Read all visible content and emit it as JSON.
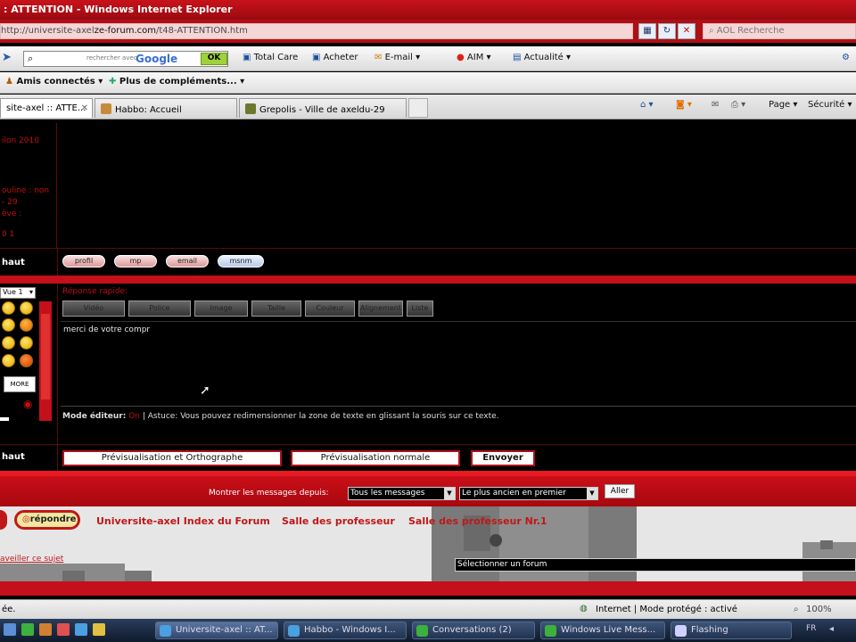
{
  "window": {
    "title": ": ATTENTION - Windows Internet Explorer"
  },
  "address": {
    "url_pre": "http://universite-axel",
    "url_host": "ze-forum.com",
    "url_post": "/t48-ATTENTION.htm",
    "search_placeholder": "AOL Recherche"
  },
  "toolbar": {
    "google_hint": "rechercher avec",
    "google": "Google",
    "ok": "OK",
    "total_care": "Total Care",
    "acheter": "Acheter",
    "email": "E-mail",
    "aim": "AIM",
    "actualite": "Actualité"
  },
  "linkbar": {
    "amis": "Amis connectés",
    "plus": "Plus de compléments..."
  },
  "tabs": [
    {
      "label": "site-axel :: ATTE..."
    },
    {
      "label": "Habbo: Accueil"
    },
    {
      "label": "Grepolis - Ville de axeldu-29"
    }
  ],
  "tabtools": {
    "page": "Page",
    "securite": "Sécurité"
  },
  "post": {
    "side_text": [
      "ilon 2010",
      "",
      "ouline : non",
      "- 29",
      "ève :",
      "",
      "0 1"
    ],
    "haut": "haut",
    "buttons": [
      "profil",
      "mp",
      "email",
      "msnm"
    ]
  },
  "reply": {
    "title": "Réponse rapide:",
    "format_buttons": [
      "Vidéo",
      "Police",
      "Image",
      "Taille",
      "Couleur",
      "Alignement",
      "Liste"
    ],
    "text": "merci de votre compr",
    "mode_label": "Mode éditeur:",
    "mode_value": "On",
    "tip": "| Astuce: Vous pouvez redimensionner la zone de texte en glissant la souris sur ce texte.",
    "smiley_select": "Vue 1",
    "more": "MORE"
  },
  "actions": {
    "haut": "haut",
    "preview_spell": "Prévisualisation et Orthographe",
    "preview": "Prévisualisation normale",
    "send": "Envoyer"
  },
  "filter": {
    "label": "Montrer les messages depuis:",
    "period": "Tous les messages",
    "order": "Le plus ancien en premier",
    "go": "Aller"
  },
  "bottomnav": {
    "reply": "répondre",
    "index": "Universite-axel Index du Forum",
    "salle": "Salle des professeur",
    "salle2": "Salle des professeur Nr.1",
    "watch": "aveiller ce sujet",
    "forum_select": "Sélectionner un forum"
  },
  "status": {
    "left": "ée.",
    "zone": "Internet | Mode protégé : activé",
    "zoom": "100%"
  },
  "taskbar": [
    {
      "label": "Universite-axel :: AT..."
    },
    {
      "label": "Habbo - Windows I..."
    },
    {
      "label": "Conversations (2)"
    },
    {
      "label": "Windows Live Mess..."
    },
    {
      "label": "Flashing"
    }
  ],
  "tray": {
    "lang": "FR"
  }
}
